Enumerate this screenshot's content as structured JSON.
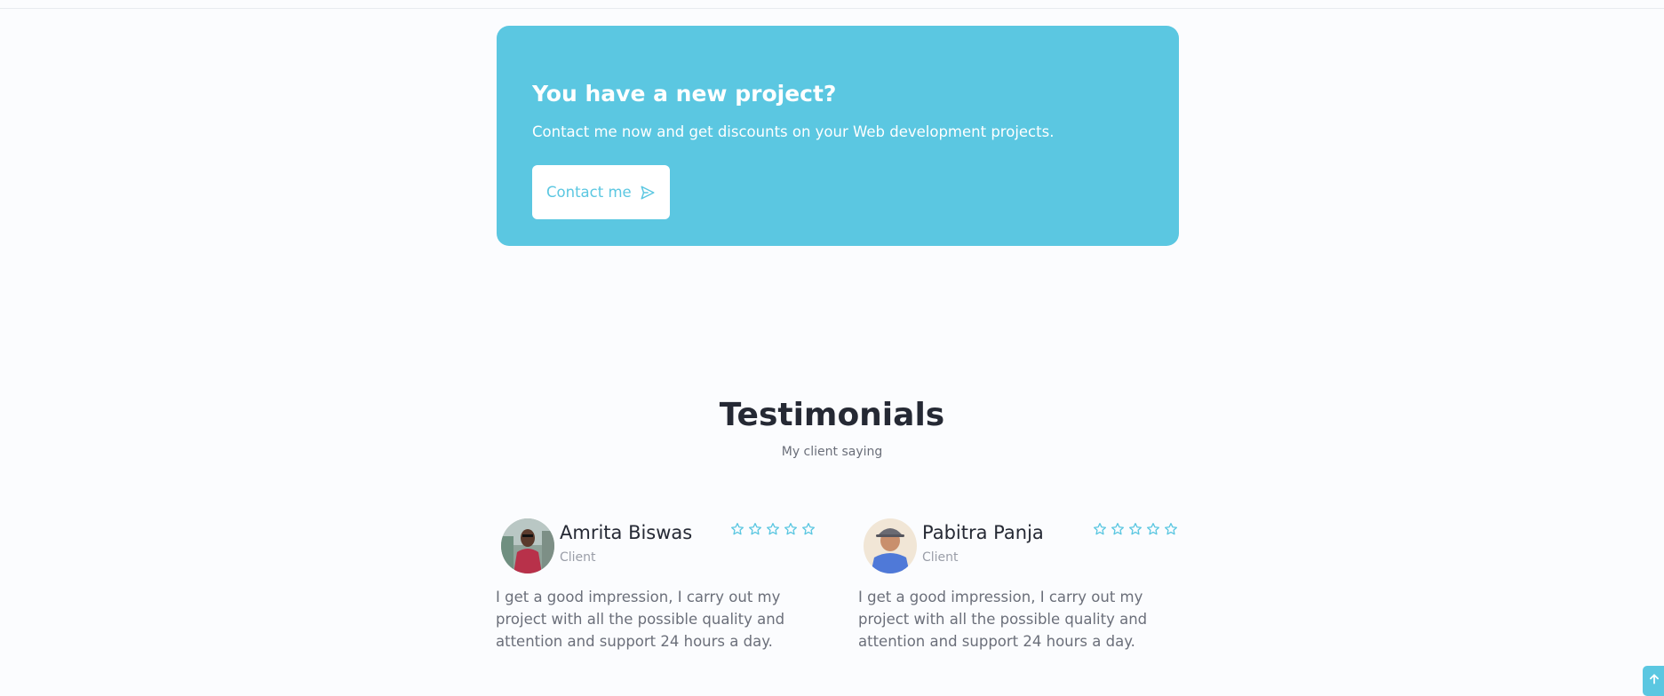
{
  "project_banner": {
    "title": "You have a new project?",
    "description": "Contact me now and get discounts on your Web development projects.",
    "button_label": "Contact me",
    "button_icon": "send-icon"
  },
  "testimonials": {
    "title": "Testimonials",
    "subtitle": "My client saying",
    "items": [
      {
        "name": "Amrita Biswas",
        "role": "Client",
        "rating": 5,
        "text": "I get a good impression, I carry out my project with all the possible quality and attention and support 24 hours a day."
      },
      {
        "name": "Pabitra Panja",
        "role": "Client",
        "rating": 5,
        "text": "I get a good impression, I carry out my project with all the possible quality and attention and support 24 hours a day."
      }
    ]
  },
  "scroll_up": {
    "icon": "arrow-up-icon"
  },
  "colors": {
    "accent": "#5bc7e1",
    "heading": "#252934",
    "text_muted": "#6b6f7a",
    "background": "#fbfcfe"
  }
}
